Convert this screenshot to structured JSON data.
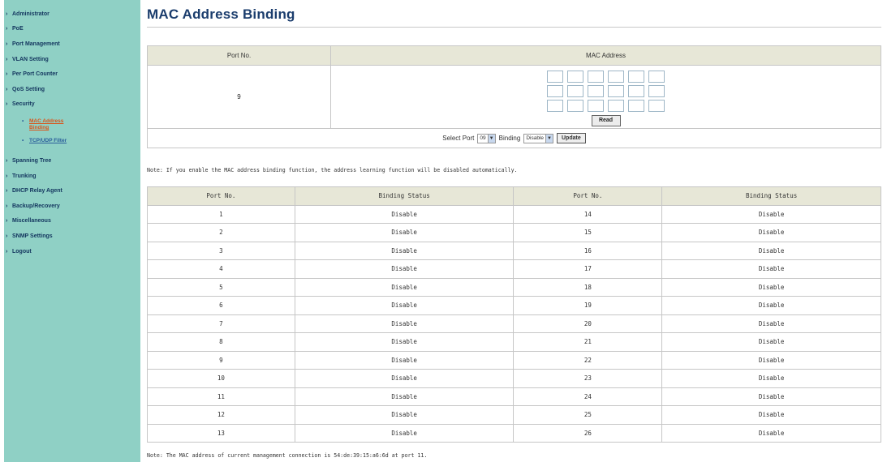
{
  "sidebar": {
    "items_before": [
      {
        "name": "sidebar-item-administrator",
        "label": "Administrator"
      },
      {
        "name": "sidebar-item-pse",
        "label": "PoE"
      },
      {
        "name": "sidebar-item-port-management",
        "label": "Port Management"
      },
      {
        "name": "sidebar-item-vlan-setting",
        "label": "VLAN Setting"
      },
      {
        "name": "sidebar-item-per-port-counter",
        "label": "Per Port Counter"
      },
      {
        "name": "sidebar-item-qos-setting",
        "label": "QoS Setting"
      },
      {
        "name": "sidebar-item-security",
        "label": "Security"
      }
    ],
    "sub_items": [
      {
        "label": "MAC Address Binding",
        "active": true
      },
      {
        "label": "TCP/UDP Filter",
        "active": false
      }
    ],
    "items_after": [
      {
        "name": "sidebar-item-spanning-tree",
        "label": "Spanning Tree"
      },
      {
        "name": "sidebar-item-trunking",
        "label": "Trunking"
      },
      {
        "name": "sidebar-item-dhcp-relay-agent",
        "label": "DHCP Relay Agent"
      },
      {
        "name": "sidebar-item-backup-recovery",
        "label": "Backup/Recovery"
      },
      {
        "name": "sidebar-item-miscellaneous",
        "label": "Miscellaneous"
      },
      {
        "name": "sidebar-item-snmp-settings",
        "label": "SNMP Settings"
      },
      {
        "name": "sidebar-item-logout",
        "label": "Logout"
      }
    ],
    "caret": "›",
    "bullet": "•"
  },
  "page": {
    "title": "MAC Address Binding"
  },
  "binding": {
    "port_header": "Port No.",
    "mac_header": "MAC Address",
    "port_value": "9",
    "read_label": "Read",
    "select_port_label": "Select Port",
    "select_port_value": "09",
    "binding_label": "Binding",
    "binding_value": "Disable",
    "update_label": "Update"
  },
  "notes": {
    "top": "Note: If you enable the MAC address binding function, the address learning function will be disabled automatically.",
    "bottom": "Note: The MAC address of current management connection is 54:de:39:15:a6:6d at port 11."
  },
  "status_table": {
    "headers": [
      "Port No.",
      "Binding Status",
      "Port No.",
      "Binding Status"
    ],
    "rows": [
      [
        "1",
        "Disable",
        "14",
        "Disable"
      ],
      [
        "2",
        "Disable",
        "15",
        "Disable"
      ],
      [
        "3",
        "Disable",
        "16",
        "Disable"
      ],
      [
        "4",
        "Disable",
        "17",
        "Disable"
      ],
      [
        "5",
        "Disable",
        "18",
        "Disable"
      ],
      [
        "6",
        "Disable",
        "19",
        "Disable"
      ],
      [
        "7",
        "Disable",
        "20",
        "Disable"
      ],
      [
        "8",
        "Disable",
        "21",
        "Disable"
      ],
      [
        "9",
        "Disable",
        "22",
        "Disable"
      ],
      [
        "10",
        "Disable",
        "23",
        "Disable"
      ],
      [
        "11",
        "Disable",
        "24",
        "Disable"
      ],
      [
        "12",
        "Disable",
        "25",
        "Disable"
      ],
      [
        "13",
        "Disable",
        "26",
        "Disable"
      ]
    ]
  },
  "colors": {
    "sidebar_bg": "#8fd0c5",
    "title": "#1b3d6d",
    "active_link": "#d9541a",
    "header_bg": "#e7e7d7"
  }
}
